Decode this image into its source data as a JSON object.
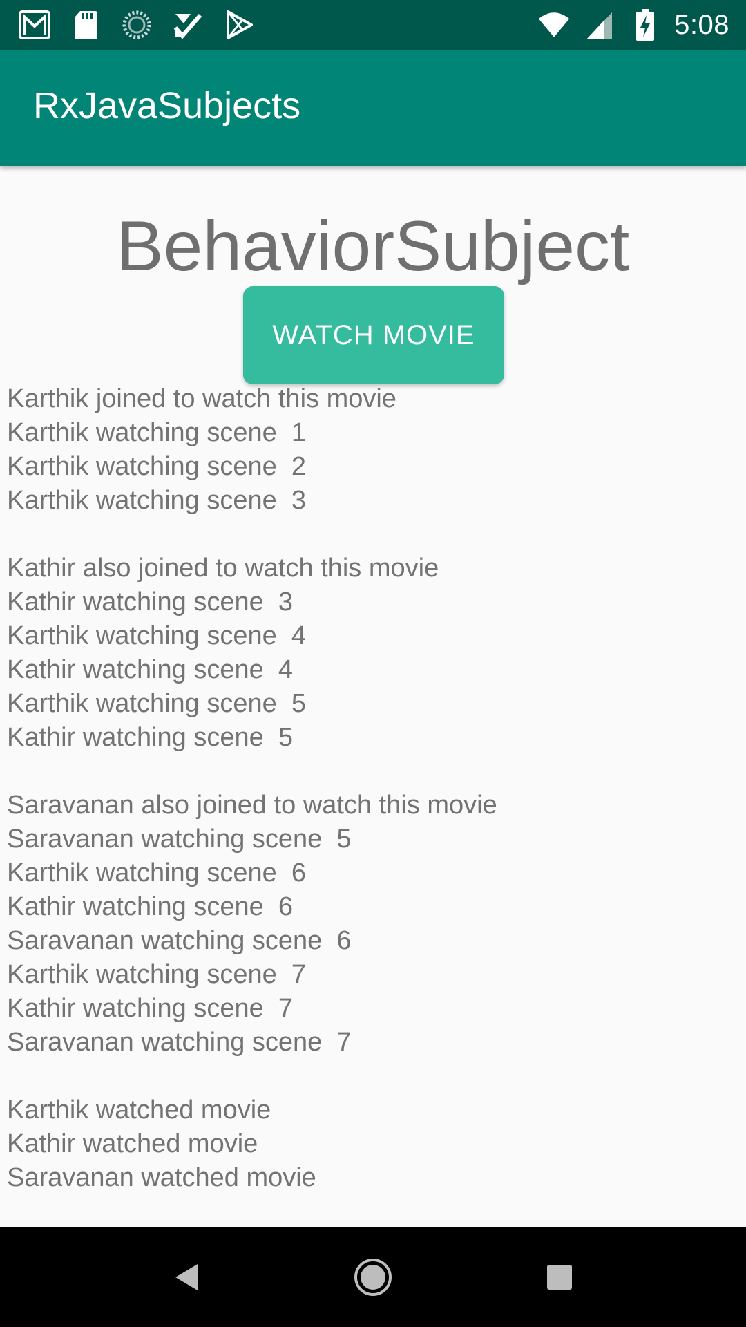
{
  "status_bar": {
    "time": "5:08",
    "left_icons": [
      "gmail-icon",
      "sd-card-icon",
      "sync-icon",
      "tasks-icon",
      "play-store-icon"
    ],
    "right_icons": [
      "wifi-icon",
      "cell-signal-icon",
      "battery-charging-icon"
    ]
  },
  "app_bar": {
    "title": "RxJavaSubjects"
  },
  "main": {
    "heading": "BehaviorSubject",
    "button_label": "WATCH MOVIE",
    "log_lines": [
      "Karthik joined to watch this movie",
      "Karthik watching scene  1",
      "Karthik watching scene  2",
      "Karthik watching scene  3",
      "",
      "Kathir also joined to watch this movie",
      "Kathir watching scene  3",
      "Karthik watching scene  4",
      "Kathir watching scene  4",
      "Karthik watching scene  5",
      "Kathir watching scene  5",
      "",
      "Saravanan also joined to watch this movie",
      "Saravanan watching scene  5",
      "Karthik watching scene  6",
      "Kathir watching scene  6",
      "Saravanan watching scene  6",
      "Karthik watching scene  7",
      "Kathir watching scene  7",
      "Saravanan watching scene  7",
      "",
      "Karthik watched movie",
      "Kathir watched movie",
      "Saravanan watched movie"
    ]
  },
  "nav_bar": {
    "icons": [
      "back-icon",
      "home-icon",
      "recents-icon"
    ]
  },
  "colors": {
    "status_bar": "#00574b",
    "app_bar": "#008577",
    "button": "#35bb9e",
    "text": "#737373",
    "background": "#fafafa"
  }
}
